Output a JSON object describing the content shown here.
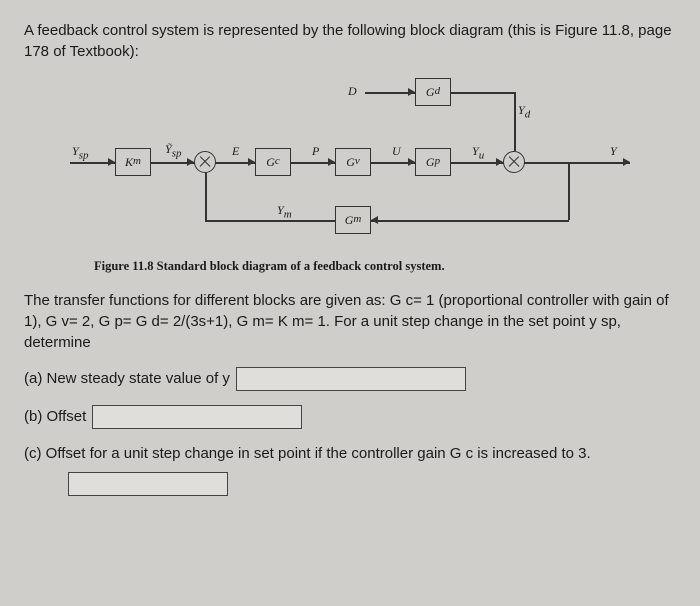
{
  "prompt": "A feedback control system is represented by the following block diagram (this is Figure 11.8, page 178 of Textbook):",
  "diagram": {
    "signals": {
      "Ysp": "Y",
      "Ysp_sub": "sp",
      "Ysp_tilde": "Ỹ",
      "Ysp_tilde_sub": "sp",
      "E": "E",
      "P": "P",
      "U": "U",
      "D": "D",
      "Yu": "Y",
      "Yu_sub": "u",
      "Yd": "Y",
      "Yd_sub": "d",
      "Y": "Y",
      "Ym": "Y",
      "Ym_sub": "m"
    },
    "blocks": {
      "Km": "K",
      "Km_sub": "m",
      "Gc": "G",
      "Gc_sub": "c",
      "Gv": "G",
      "Gv_sub": "v",
      "Gp": "G",
      "Gp_sub": "p",
      "Gd": "G",
      "Gd_sub": "d",
      "Gm": "G",
      "Gm_sub": "m"
    }
  },
  "caption": "Figure 11.8 Standard block diagram of a feedback control system.",
  "body": "The transfer functions for different blocks are given as: G c= 1 (proportional controller with gain of 1), G v= 2, G p= G d= 2/(3s+1), G m= K m= 1. For a unit step change in the set point y sp, determine",
  "qa": {
    "a_label": "(a)  New steady state value of y",
    "a_value": "",
    "b_label": "(b)  Offset",
    "b_value": "",
    "c_label": "(c)   Offset for a unit step change in set point if the controller gain G c is increased to 3.",
    "c_value": ""
  }
}
